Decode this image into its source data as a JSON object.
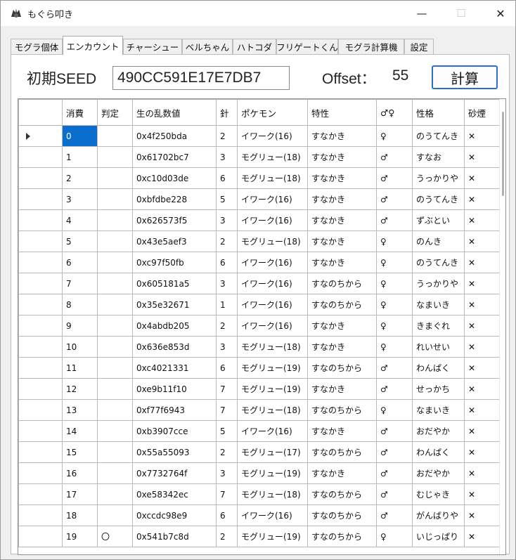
{
  "window": {
    "title": "もぐら叩き"
  },
  "tabs": [
    "モグラ個体",
    "エンカウント",
    "チャーシュー",
    "ベルちゃん",
    "ハトコダ",
    "フリゲートくん",
    "モグラ計算機",
    "設定"
  ],
  "form": {
    "seed_label": "初期SEED",
    "seed_value": "490CC591E17E7DB7",
    "offset_label": "Offset：",
    "offset_value": "55",
    "calc_button": "計算"
  },
  "grid": {
    "columns": [
      "消費",
      "判定",
      "生の乱数値",
      "針",
      "ポケモン",
      "特性",
      "♂♀",
      "性格",
      "砂煙"
    ],
    "rows": [
      [
        "0",
        "",
        "0x4f250bda",
        "2",
        "イワーク(16)",
        "すなかき",
        "♀",
        "のうてんき",
        "✕"
      ],
      [
        "1",
        "",
        "0x61702bc7",
        "3",
        "モグリュー(18)",
        "すなかき",
        "♂",
        "すなお",
        "✕"
      ],
      [
        "2",
        "",
        "0xc10d03de",
        "6",
        "モグリュー(18)",
        "すなかき",
        "♂",
        "うっかりや",
        "✕"
      ],
      [
        "3",
        "",
        "0xbfdbe228",
        "5",
        "イワーク(16)",
        "すなかき",
        "♂",
        "のうてんき",
        "✕"
      ],
      [
        "4",
        "",
        "0x626573f5",
        "3",
        "イワーク(16)",
        "すなかき",
        "♂",
        "ずぶとい",
        "✕"
      ],
      [
        "5",
        "",
        "0x43e5aef3",
        "2",
        "モグリュー(18)",
        "すなかき",
        "♀",
        "のんき",
        "✕"
      ],
      [
        "6",
        "",
        "0xc97f50fb",
        "6",
        "イワーク(16)",
        "すなかき",
        "♀",
        "のうてんき",
        "✕"
      ],
      [
        "7",
        "",
        "0x605181a5",
        "3",
        "イワーク(16)",
        "すなのちから",
        "♀",
        "うっかりや",
        "✕"
      ],
      [
        "8",
        "",
        "0x35e32671",
        "1",
        "イワーク(16)",
        "すなのちから",
        "♀",
        "なまいき",
        "✕"
      ],
      [
        "9",
        "",
        "0x4abdb205",
        "2",
        "イワーク(16)",
        "すなかき",
        "♀",
        "きまぐれ",
        "✕"
      ],
      [
        "10",
        "",
        "0x636e853d",
        "3",
        "モグリュー(18)",
        "すなかき",
        "♀",
        "れいせい",
        "✕"
      ],
      [
        "11",
        "",
        "0xc4021331",
        "6",
        "モグリュー(19)",
        "すなのちから",
        "♂",
        "わんぱく",
        "✕"
      ],
      [
        "12",
        "",
        "0xe9b11f10",
        "7",
        "モグリュー(19)",
        "すなかき",
        "♂",
        "せっかち",
        "✕"
      ],
      [
        "13",
        "",
        "0xf77f6943",
        "7",
        "モグリュー(18)",
        "すなのちから",
        "♀",
        "なまいき",
        "✕"
      ],
      [
        "14",
        "",
        "0xb3907cce",
        "5",
        "イワーク(16)",
        "すなかき",
        "♂",
        "おだやか",
        "✕"
      ],
      [
        "15",
        "",
        "0x55a55093",
        "2",
        "モグリュー(17)",
        "すなのちから",
        "♂",
        "わんぱく",
        "✕"
      ],
      [
        "16",
        "",
        "0x7732764f",
        "3",
        "モグリュー(19)",
        "すなかき",
        "♂",
        "おだやか",
        "✕"
      ],
      [
        "17",
        "",
        "0xe58342ec",
        "7",
        "モグリュー(18)",
        "すなのちから",
        "♂",
        "むじゃき",
        "✕"
      ],
      [
        "18",
        "",
        "0xccdc98e9",
        "6",
        "イワーク(16)",
        "すなのちから",
        "♂",
        "がんばりや",
        "✕"
      ],
      [
        "19",
        "〇",
        "0x541b7c8d",
        "2",
        "モグリュー(19)",
        "すなのちから",
        "♀",
        "いじっぱり",
        "✕"
      ]
    ]
  },
  "colors": {
    "selection": "#0a6ecf",
    "button_border": "#2a6ed1"
  },
  "icons": {
    "app": "mole-icon",
    "current_row": "row-pointer-icon"
  }
}
